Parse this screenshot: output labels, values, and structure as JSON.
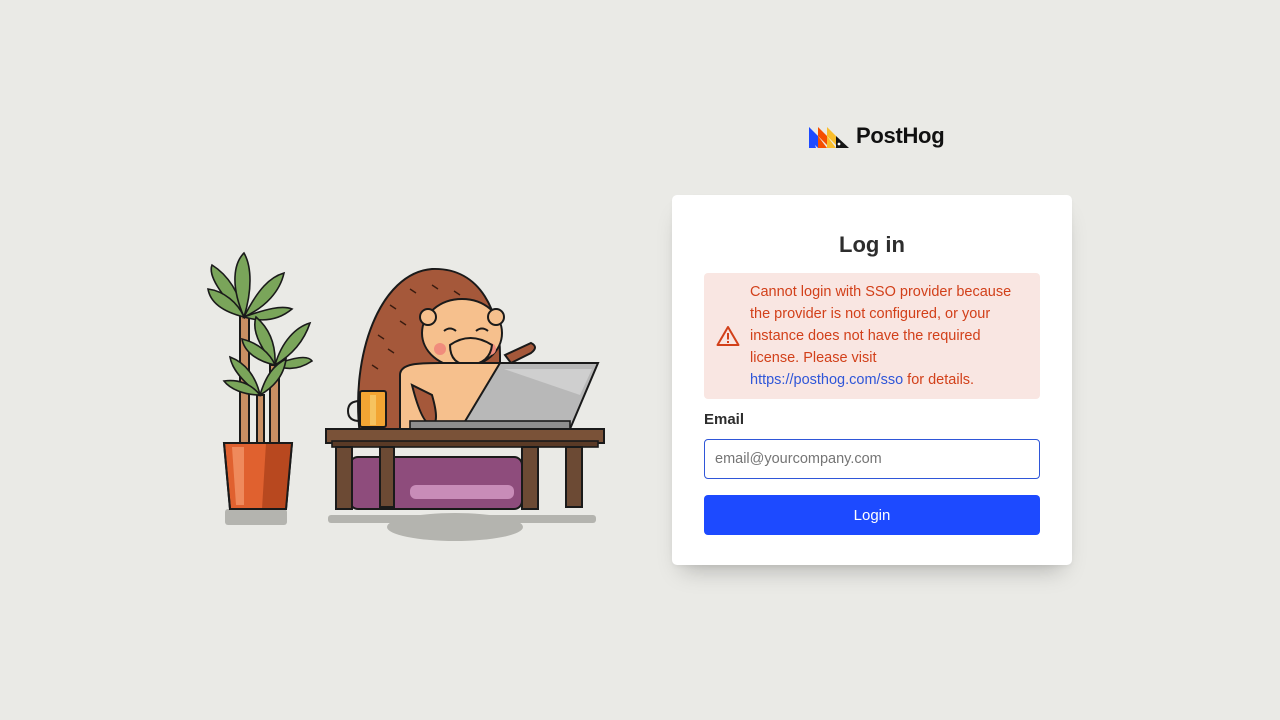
{
  "brand": {
    "name": "PostHog",
    "logo_icon": "posthog-hedgehog-logo",
    "colors": {
      "blue": "#1d4aff",
      "orange": "#f54e00",
      "yellow": "#f9bd2b",
      "dark": "#151515"
    }
  },
  "illustration": {
    "icon": "hedgehog-at-desk-illustration"
  },
  "login": {
    "title": "Log in",
    "alert": {
      "icon": "warning-triangle-icon",
      "message": "Cannot login with SSO provider because the provider is not configured, or your instance does not have the required license. Please visit",
      "link_text": "https://posthog.com/sso",
      "suffix": "for details.",
      "color": "#d2401a",
      "background": "#f9e6e2"
    },
    "email": {
      "label": "Email",
      "value": "",
      "placeholder": "email@yourcompany.com"
    },
    "button_label": "Login"
  },
  "colors": {
    "page_background": "#eaeae6",
    "primary": "#1d4aff",
    "link": "#2f56d8"
  }
}
